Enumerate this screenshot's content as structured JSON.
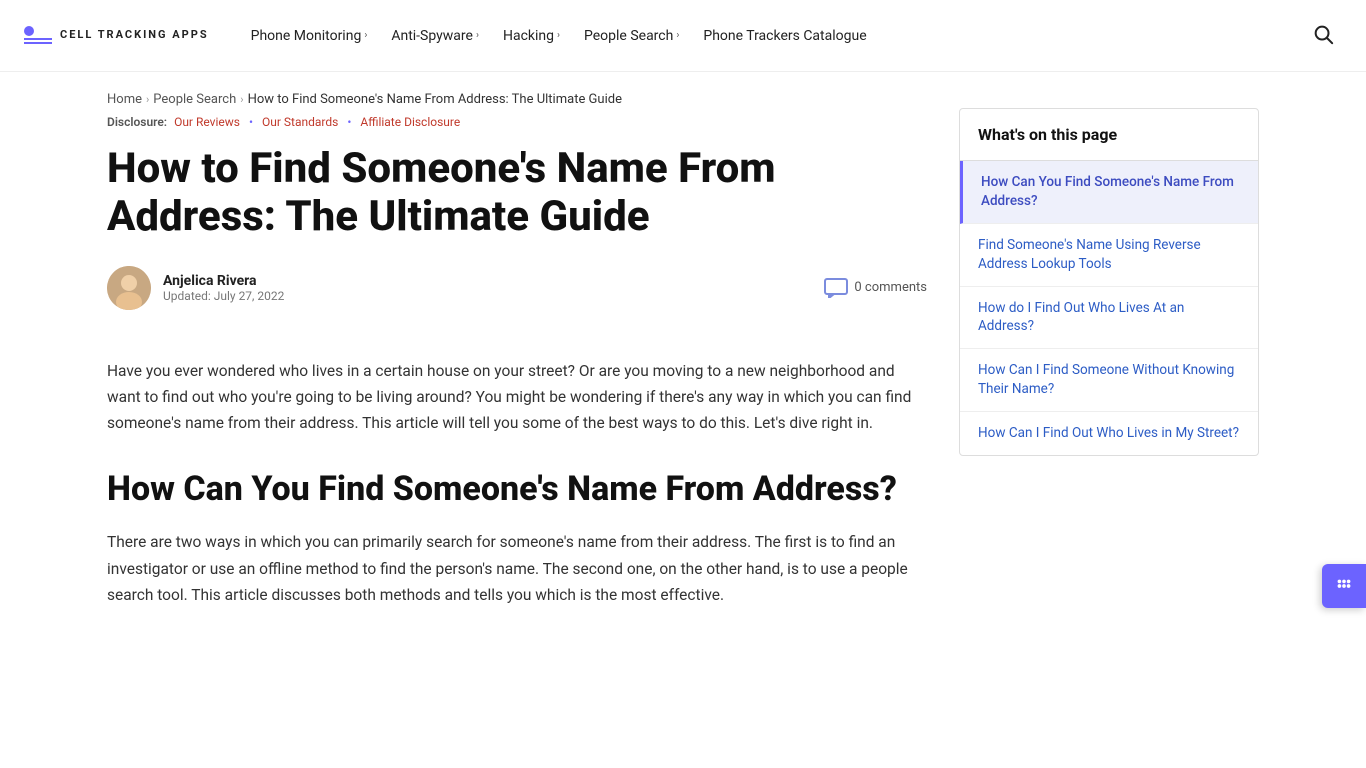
{
  "site": {
    "name": "CELL TRACKING APPS",
    "logo_lines": [
      "CELL",
      "TRACKING",
      "APPS"
    ]
  },
  "nav": {
    "items": [
      {
        "label": "Phone Monitoring",
        "has_chevron": true
      },
      {
        "label": "Anti-Spyware",
        "has_chevron": true
      },
      {
        "label": "Hacking",
        "has_chevron": true
      },
      {
        "label": "People Search",
        "has_chevron": true
      },
      {
        "label": "Phone Trackers Catalogue",
        "has_chevron": false
      }
    ]
  },
  "breadcrumb": {
    "items": [
      {
        "label": "Home",
        "sep": "›"
      },
      {
        "label": "People Search",
        "sep": "›"
      },
      {
        "label": "How to Find Someone's Name From Address: The Ultimate Guide",
        "sep": ""
      }
    ]
  },
  "disclosure": {
    "label": "Disclosure:",
    "links": [
      {
        "label": "Our Reviews"
      },
      {
        "label": "Our Standards"
      },
      {
        "label": "Affiliate Disclosure"
      }
    ]
  },
  "article": {
    "title": "How to Find Someone's Name From Address: The Ultimate Guide",
    "author": {
      "name": "Anjelica Rivera",
      "date": "Updated: July 27, 2022"
    },
    "comments_count": "0 comments",
    "intro_paragraph": "Have you ever wondered who lives in a certain house on your street? Or are you moving to a new neighborhood and want to find out who you're going to be living around? You might be wondering if there's any way in which you can find someone's name from their address. This article will tell you some of the best ways to do this. Let's dive right in.",
    "section1_title": "How Can You Find Someone's Name From Address?",
    "section1_paragraph": "There are two ways in which you can primarily search for someone's name from their address. The first is to find an investigator or use an offline method to find the person's name. The second one, on the other hand, is to use a people search tool. This article discusses both methods and tells you which is the most effective."
  },
  "toc": {
    "title": "What's on this page",
    "items": [
      {
        "label": "How Can You Find Someone's Name From Address?",
        "active": true
      },
      {
        "label": "Find Someone's Name Using Reverse Address Lookup Tools",
        "active": false
      },
      {
        "label": "How do I Find Out Who Lives At an Address?",
        "active": false
      },
      {
        "label": "How Can I Find Someone Without Knowing Their Name?",
        "active": false
      },
      {
        "label": "How Can I Find Out Who Lives in My Street?",
        "active": false
      }
    ]
  },
  "float_btn": {
    "icon": "☰"
  }
}
